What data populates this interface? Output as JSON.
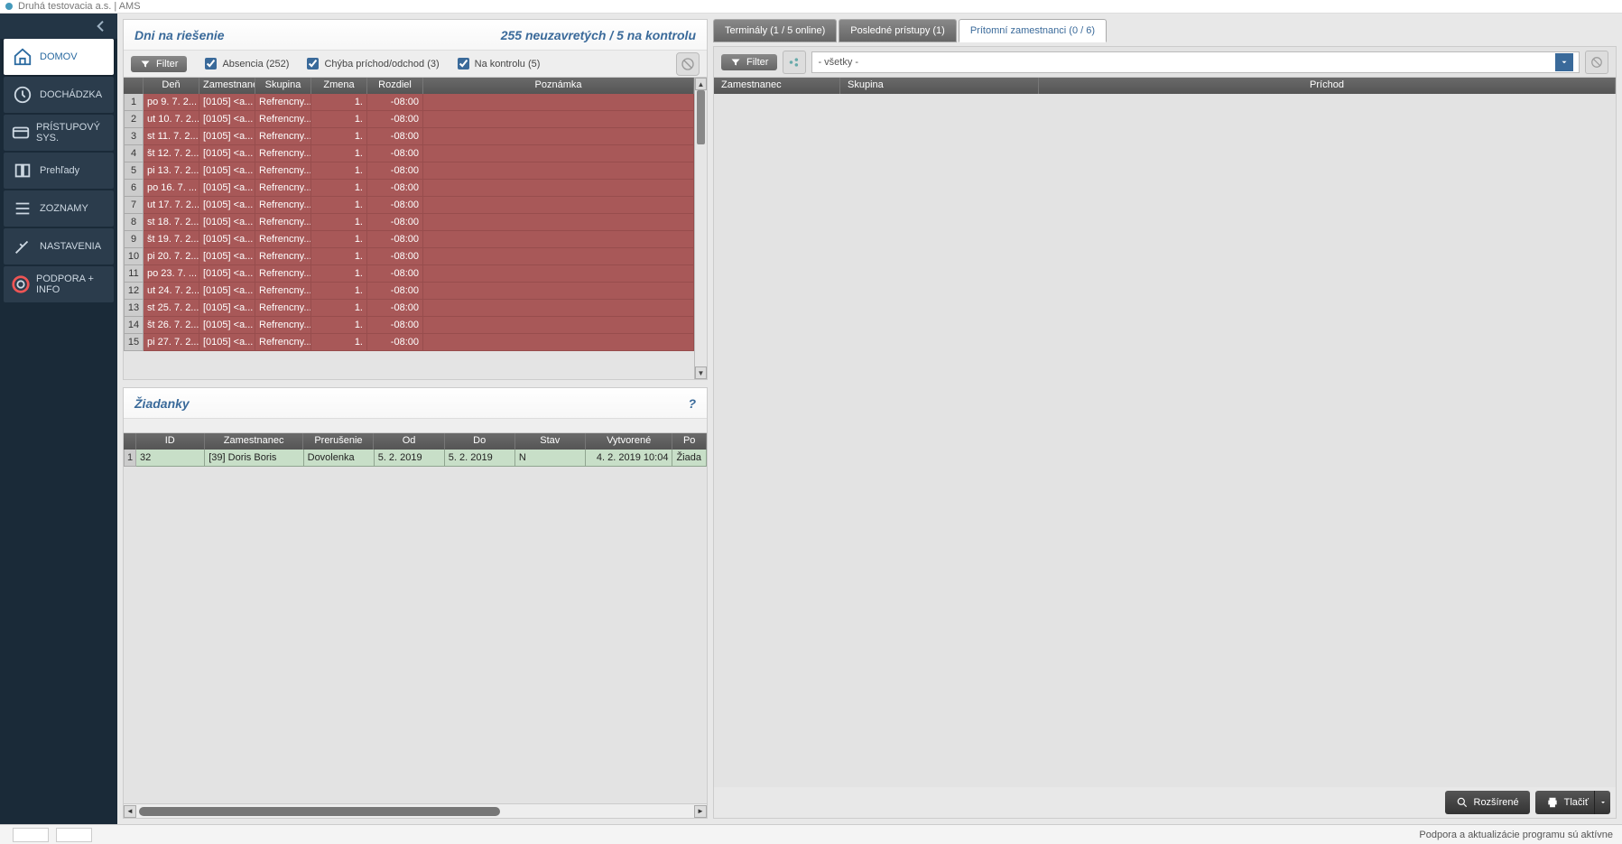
{
  "titlebar": {
    "text": "Druhá testovacia a.s. | AMS"
  },
  "sidebar": {
    "items": [
      {
        "label": "DOMOV"
      },
      {
        "label": "DOCHÁDZKA"
      },
      {
        "label": "PRÍSTUPOVÝ SYS."
      },
      {
        "label": "Prehľady"
      },
      {
        "label": "ZOZNAMY"
      },
      {
        "label": "NASTAVENIA"
      },
      {
        "label": "PODPORA + INFO"
      }
    ]
  },
  "panel1": {
    "title": "Dni na riešenie",
    "status": "255 neuzavretých / 5 na kontrolu",
    "filter_btn": "Filter",
    "chk1": "Absencia (252)",
    "chk2": "Chýba príchod/odchod (3)",
    "chk3": "Na kontrolu (5)",
    "cols": {
      "den": "Deň",
      "zam": "Zamestnanec",
      "sku": "Skupina",
      "zme": "Zmena",
      "roz": "Rozdiel",
      "poz": "Poznámka"
    },
    "rows": [
      {
        "den": "po 9. 7. 2...",
        "zam": "[0105] <a...",
        "sku": "Refrencny...",
        "zme": "1.",
        "roz": "-08:00"
      },
      {
        "den": "ut 10. 7. 2...",
        "zam": "[0105] <a...",
        "sku": "Refrencny...",
        "zme": "1.",
        "roz": "-08:00"
      },
      {
        "den": "st 11. 7. 2...",
        "zam": "[0105] <a...",
        "sku": "Refrencny...",
        "zme": "1.",
        "roz": "-08:00"
      },
      {
        "den": "št 12. 7. 2...",
        "zam": "[0105] <a...",
        "sku": "Refrencny...",
        "zme": "1.",
        "roz": "-08:00"
      },
      {
        "den": "pi 13. 7. 2...",
        "zam": "[0105] <a...",
        "sku": "Refrencny...",
        "zme": "1.",
        "roz": "-08:00"
      },
      {
        "den": "po 16. 7. ...",
        "zam": "[0105] <a...",
        "sku": "Refrencny...",
        "zme": "1.",
        "roz": "-08:00"
      },
      {
        "den": "ut 17. 7. 2...",
        "zam": "[0105] <a...",
        "sku": "Refrencny...",
        "zme": "1.",
        "roz": "-08:00"
      },
      {
        "den": "st 18. 7. 2...",
        "zam": "[0105] <a...",
        "sku": "Refrencny...",
        "zme": "1.",
        "roz": "-08:00"
      },
      {
        "den": "št 19. 7. 2...",
        "zam": "[0105] <a...",
        "sku": "Refrencny...",
        "zme": "1.",
        "roz": "-08:00"
      },
      {
        "den": "pi 20. 7. 2...",
        "zam": "[0105] <a...",
        "sku": "Refrencny...",
        "zme": "1.",
        "roz": "-08:00"
      },
      {
        "den": "po 23. 7. ...",
        "zam": "[0105] <a...",
        "sku": "Refrencny...",
        "zme": "1.",
        "roz": "-08:00"
      },
      {
        "den": "ut 24. 7. 2...",
        "zam": "[0105] <a...",
        "sku": "Refrencny...",
        "zme": "1.",
        "roz": "-08:00"
      },
      {
        "den": "st 25. 7. 2...",
        "zam": "[0105] <a...",
        "sku": "Refrencny...",
        "zme": "1.",
        "roz": "-08:00"
      },
      {
        "den": "št 26. 7. 2...",
        "zam": "[0105] <a...",
        "sku": "Refrencny...",
        "zme": "1.",
        "roz": "-08:00"
      },
      {
        "den": "pi 27. 7. 2...",
        "zam": "[0105] <a...",
        "sku": "Refrencny...",
        "zme": "1.",
        "roz": "-08:00"
      }
    ]
  },
  "panel2": {
    "title": "Žiadanky",
    "q": "?",
    "cols": {
      "id": "ID",
      "zam": "Zamestnanec",
      "pre": "Prerušenie",
      "od": "Od",
      "do": "Do",
      "sta": "Stav",
      "vyt": "Vytvorené",
      "pod": "Po"
    },
    "rows": [
      {
        "id": "32",
        "zam": "[39] Doris Boris",
        "pre": "Dovolenka",
        "od": "5. 2. 2019",
        "do": "5. 2. 2019",
        "sta": "N",
        "vyt": "4. 2. 2019  10:04",
        "pod": "Žiada"
      }
    ]
  },
  "right": {
    "tabs": [
      {
        "label": "Terminály (1 / 5 online)"
      },
      {
        "label": "Posledné prístupy (1)"
      },
      {
        "label": "Prítomní zamestnanci (0 / 6)"
      }
    ],
    "filter_btn": "Filter",
    "select_value": "- všetky -",
    "cols": {
      "zam": "Zamestnanec",
      "sku": "Skupina",
      "pri": "Príchod"
    },
    "btn_expand": "Rozšírené",
    "btn_print": "Tlačiť"
  },
  "statusbar": {
    "text": "Podpora a aktualizácie programu sú aktívne"
  }
}
